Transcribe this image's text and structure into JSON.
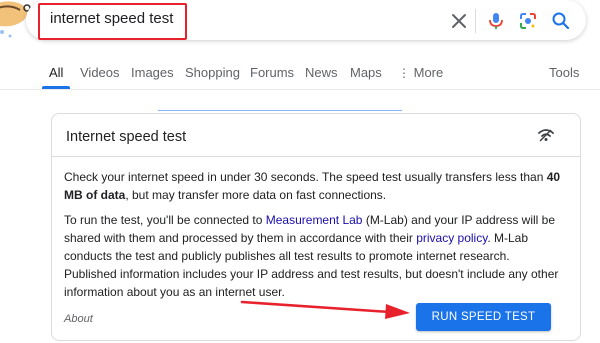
{
  "search": {
    "query": "internet speed test"
  },
  "tabs": [
    "All",
    "Videos",
    "Images",
    "Shopping",
    "Forums",
    "News",
    "Maps",
    "More"
  ],
  "tools_label": "Tools",
  "card": {
    "title": "Internet speed test",
    "para1_a": "Check your internet speed in under 30 seconds. The speed test usually transfers less than ",
    "para1_bold": "40 MB of data",
    "para1_b": ", but may transfer more data on fast connections.",
    "para2_a": "To run the test, you'll be connected to ",
    "para2_link1": "Measurement Lab",
    "para2_b": " (M-Lab) and your IP address will be shared with them and processed by them in accordance with their ",
    "para2_link2": "privacy policy",
    "para2_c": ". M-Lab conducts the test and publicly publishes all test results to promote internet research. Published information includes your IP address and test results, but doesn't include any other information about you as an internet user.",
    "about": "About",
    "run_button": "RUN SPEED TEST"
  },
  "colors": {
    "accent": "#1a73e8",
    "annotation_red": "#e8222c",
    "link": "#1a0dab"
  },
  "icons": [
    "clear-icon",
    "microphone-icon",
    "lens-icon",
    "search-icon",
    "wifi-icon",
    "more-dots-icon"
  ]
}
